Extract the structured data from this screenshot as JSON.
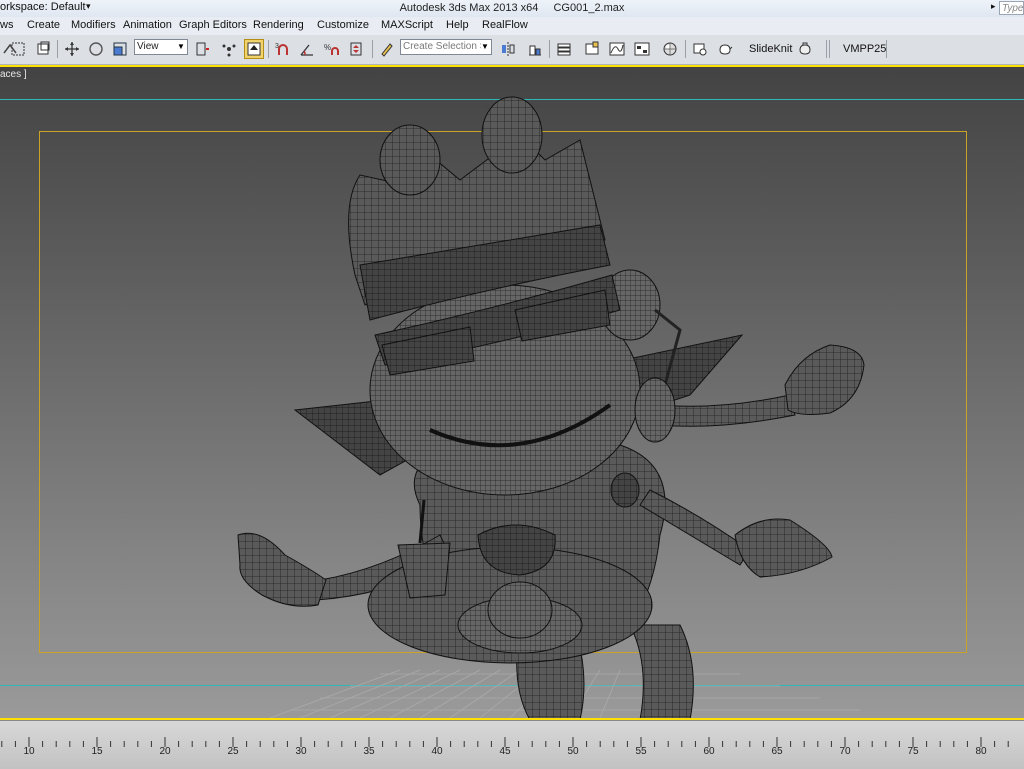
{
  "titlebar": {
    "workspace": "orkspace: Default",
    "app_name": "Autodesk 3ds Max  2013 x64",
    "file_name": "CG001_2.max",
    "search_placeholder": "Type a"
  },
  "menu": [
    "ws",
    "Create",
    "Modifiers",
    "Animation",
    "Graph Editors",
    "Rendering",
    "Customize",
    "MAXScript",
    "Help",
    "RealFlow"
  ],
  "toolbar": {
    "view_combo": "View",
    "selection_set_placeholder": "Create Selection Set",
    "slideknit_label": "SlideKnit",
    "vmpp_label": "VMPP25",
    "icons": [
      "snap-icon",
      "select-region-icon",
      "window-crossing-icon",
      "move-icon",
      "rotate-icon",
      "scale-icon",
      "reference-coord-icon",
      "pivot-icon",
      "select-manipulate-icon",
      "snap-toggle-icon",
      "angle-snap-icon",
      "percent-snap-icon",
      "spinner-snap-icon",
      "edit-named-selection-icon",
      "mirror-icon",
      "align-icon",
      "layer-manager-icon",
      "graphite-icon",
      "curve-editor-icon",
      "schematic-view-icon",
      "material-editor-icon",
      "render-setup-icon",
      "rendered-frame-icon",
      "teapot-render-icon"
    ]
  },
  "viewport": {
    "label": "aces ]"
  },
  "timeline": {
    "ticks": [
      "10",
      "15",
      "20",
      "25",
      "30",
      "35",
      "40",
      "45",
      "50",
      "55",
      "60",
      "65",
      "70",
      "75",
      "80"
    ]
  }
}
